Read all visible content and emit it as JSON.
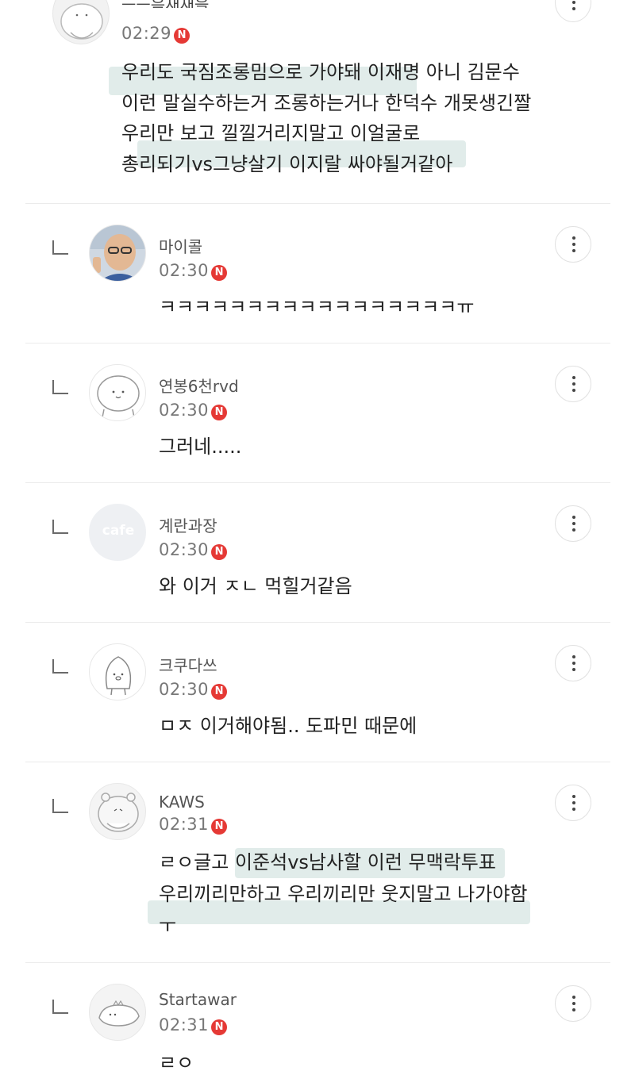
{
  "top_comment": {
    "nickname": "ㅡㅡ음새새을",
    "time": "02:29",
    "badge": "N",
    "lines": [
      "우리도 국짐조롱밈으로 가야돼 이재명 아니 김문수",
      "이런 말실수하는거 조롱하는거나 한덕수 개못생긴짤",
      "우리만 보고 낄낄거리지말고 이얼굴로",
      "총리되기vs그냥살기 이지랄 싸야될거같아"
    ]
  },
  "replies": [
    {
      "nickname": "마이콜",
      "time": "02:30",
      "badge": "N",
      "lines": [
        "ㅋㅋㅋㅋㅋㅋㅋㅋㅋㅋㅋㅋㅋㅋㅋㅋㅋㅠ"
      ]
    },
    {
      "nickname": "연봉6천rvd",
      "time": "02:30",
      "badge": "N",
      "lines": [
        "그러네....."
      ]
    },
    {
      "nickname": "계란과장",
      "time": "02:30",
      "badge": "N",
      "avatar_text": "cafe",
      "lines": [
        "와 이거 ㅈㄴ 먹힐거같음"
      ]
    },
    {
      "nickname": "크쿠다쓰",
      "time": "02:30",
      "badge": "N",
      "lines": [
        "ㅁㅈ 이거해야됨.. 도파민 때문에"
      ]
    },
    {
      "nickname": "KAWS",
      "time": "02:31",
      "badge": "N",
      "lines": [
        "ㄹㅇ글고 이준석vs남사할 이런 무맥락투표",
        "우리끼리만하고 우리끼리만 웃지말고 나가야함",
        "ㅜ"
      ]
    },
    {
      "nickname": "Startawar",
      "time": "02:31",
      "badge": "N",
      "lines": [
        "ㄹㅇ"
      ]
    }
  ],
  "colors": {
    "badge": "#e53935",
    "highlight": "#cfe3dd",
    "divider": "#ebebeb"
  }
}
